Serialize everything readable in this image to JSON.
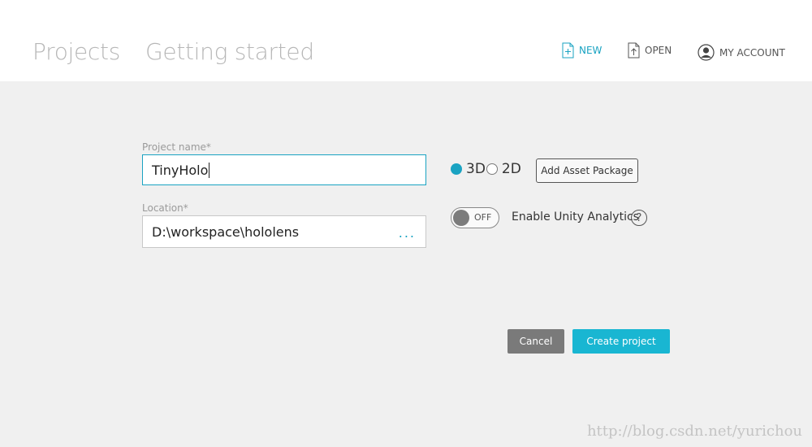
{
  "header": {
    "tabs": [
      {
        "label": "Projects"
      },
      {
        "label": "Getting started"
      }
    ],
    "actions": {
      "new_label": "NEW",
      "open_label": "OPEN",
      "account_label": "MY ACCOUNT"
    }
  },
  "form": {
    "project_name": {
      "label": "Project name*",
      "value": "TinyHolo"
    },
    "location": {
      "label": "Location*",
      "value": "D:\\workspace\\hololens",
      "browse_label": "..."
    },
    "mode": {
      "options": [
        {
          "label": "3D",
          "selected": true
        },
        {
          "label": "2D",
          "selected": false
        }
      ]
    },
    "add_asset_package_label": "Add Asset Package",
    "analytics": {
      "toggle_label": "OFF",
      "label": "Enable Unity Analytics",
      "help": "?"
    }
  },
  "buttons": {
    "cancel_label": "Cancel",
    "create_label": "Create project"
  },
  "watermark": "http://blog.csdn.net/yurichou",
  "colors": {
    "accent": "#1aa3c2",
    "primary_button": "#19b6d2",
    "cancel_button": "#7a7a7a",
    "background": "#f0f0f0"
  }
}
